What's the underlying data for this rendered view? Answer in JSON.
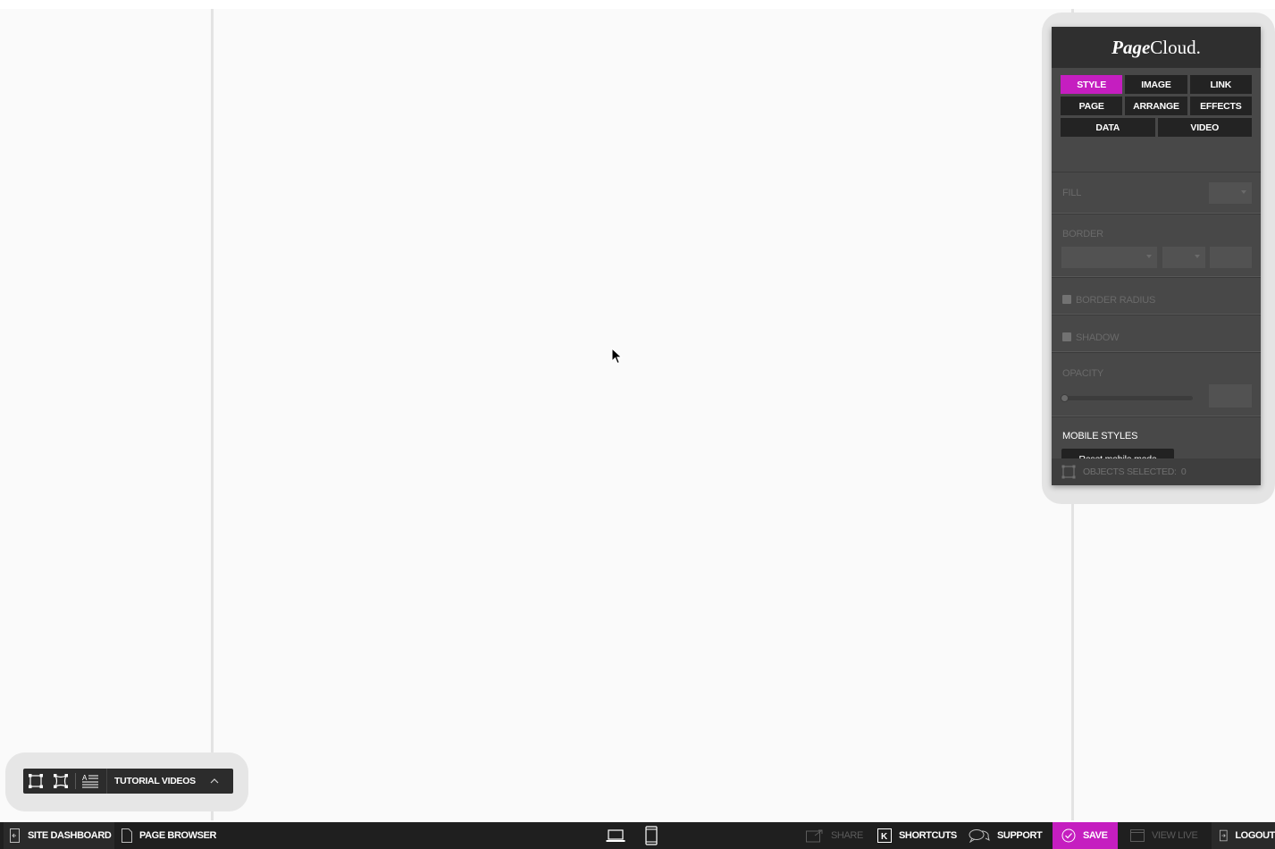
{
  "panel": {
    "brand_script": "Page",
    "brand_text": "Cloud.",
    "tabs_row1": [
      "STYLE",
      "IMAGE",
      "LINK"
    ],
    "tabs_row2": [
      "PAGE",
      "ARRANGE",
      "EFFECTS"
    ],
    "tabs_row3": [
      "DATA",
      "VIDEO"
    ],
    "active_tab": "STYLE",
    "fill_label": "FILL",
    "border_label": "BORDER",
    "border_radius_label": "BORDER RADIUS",
    "shadow_label": "SHADOW",
    "opacity_label": "OPACITY",
    "opacity_value": 0,
    "mobile_styles_label": "MOBILE STYLES",
    "reset_mobile_label": "Reset mobile mode",
    "objects_selected_label": "OBJECTS SELECTED:",
    "objects_selected_count": "0"
  },
  "float_toolbar": {
    "icons": [
      "rectangle-select-icon",
      "free-select-icon",
      "text-block-icon"
    ],
    "tutorial_label": "TUTORIAL VIDEOS"
  },
  "bottom_bar": {
    "site_dashboard": "SITE DASHBOARD",
    "page_browser": "PAGE BROWSER",
    "share": "SHARE",
    "shortcuts": "SHORTCUTS",
    "support": "SUPPORT",
    "save": "SAVE",
    "view_live": "VIEW LIVE",
    "logout": "LOGOUT"
  },
  "colors": {
    "accent": "#c51ec0",
    "panel_bg": "#484848",
    "bar_bg": "#1f1f1f"
  }
}
